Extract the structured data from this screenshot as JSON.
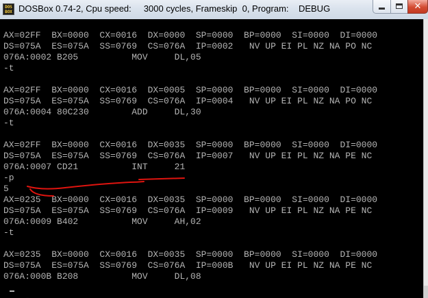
{
  "window": {
    "title": "DOSBox 0.74-2, Cpu speed:     3000 cycles, Frameskip  0, Program:    DEBUG",
    "icon_top": "DOS",
    "icon_bottom": "BOX",
    "close_glyph": "✕"
  },
  "console": {
    "lines": [
      "AX=02FF  BX=0000  CX=0016  DX=0000  SP=0000  BP=0000  SI=0000  DI=0000",
      "DS=075A  ES=075A  SS=0769  CS=076A  IP=0002   NV UP EI PL NZ NA PO NC",
      "076A:0002 B205          MOV     DL,05",
      "-t",
      "",
      "AX=02FF  BX=0000  CX=0016  DX=0005  SP=0000  BP=0000  SI=0000  DI=0000",
      "DS=075A  ES=075A  SS=0769  CS=076A  IP=0004   NV UP EI PL NZ NA PO NC",
      "076A:0004 80C230        ADD     DL,30",
      "-t",
      "",
      "AX=02FF  BX=0000  CX=0016  DX=0035  SP=0000  BP=0000  SI=0000  DI=0000",
      "DS=075A  ES=075A  SS=0769  CS=076A  IP=0007   NV UP EI PL NZ NA PE NC",
      "076A:0007 CD21          INT     21",
      "-p",
      "5",
      "AX=0235  BX=0000  CX=0016  DX=0035  SP=0000  BP=0000  SI=0000  DI=0000",
      "DS=075A  ES=075A  SS=0769  CS=076A  IP=0009   NV UP EI PL NZ NA PE NC",
      "076A:0009 B402          MOV     AH,02",
      "-t",
      "",
      "AX=0235  BX=0000  CX=0016  DX=0035  SP=0000  BP=0000  SI=0000  DI=0000",
      "DS=075A  ES=075A  SS=0769  CS=076A  IP=000B   NV UP EI PL NZ NA PE NC",
      "076A:000B B208          MOV     DL,08"
    ],
    "prompt": "-",
    "text_color": "#b4b4b4",
    "background_color": "#000000"
  },
  "annotation": {
    "color": "#e0140f"
  }
}
